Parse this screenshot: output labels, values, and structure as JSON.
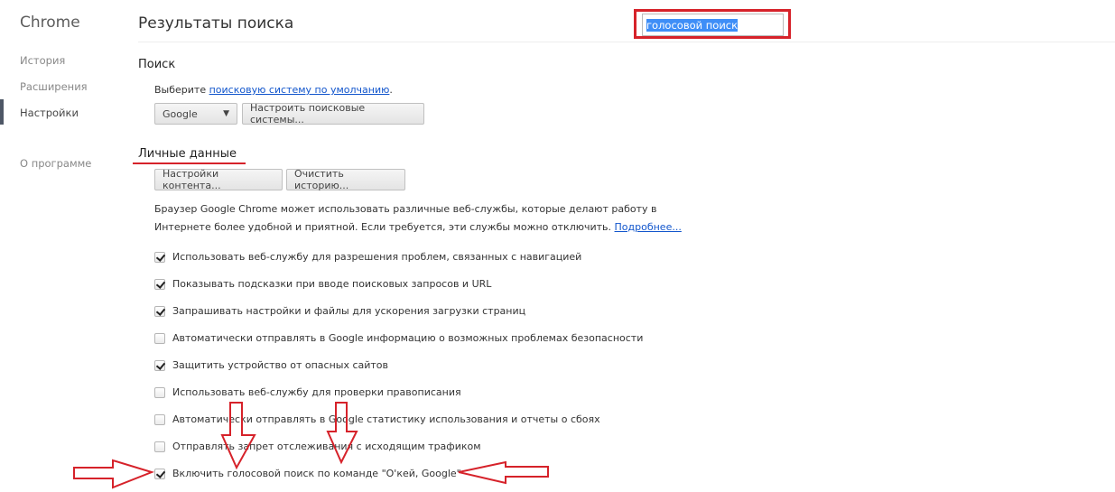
{
  "sidebar": {
    "brand": "Chrome",
    "items": [
      {
        "label": "История"
      },
      {
        "label": "Расширения"
      },
      {
        "label": "Настройки",
        "active": true
      },
      {
        "label": "О программе"
      }
    ]
  },
  "header": {
    "title": "Результаты поиска",
    "search_value": "голосовой поиск"
  },
  "search_section": {
    "heading": "Поиск",
    "prefix": "Выберите ",
    "link": "поисковую систему по умолчанию",
    "suffix": ".",
    "engine": "Google",
    "manage_button": "Настроить поисковые системы..."
  },
  "privacy": {
    "heading": "Личные данные",
    "content_settings": "Настройки контента...",
    "clear_history": "Очистить историю...",
    "description": "Браузер Google Chrome может использовать различные веб-службы, которые делают работу в Интернете более удобной и приятной. Если требуется, эти службы можно отключить. ",
    "more_link": "Подробнее...",
    "options": [
      {
        "label": "Использовать веб-службу для разрешения проблем, связанных с навигацией",
        "checked": true
      },
      {
        "label": "Показывать подсказки при вводе поисковых запросов и URL",
        "checked": true
      },
      {
        "label": "Запрашивать настройки и файлы для ускорения загрузки страниц",
        "checked": true
      },
      {
        "label": "Автоматически отправлять в Google информацию о возможных проблемах безопасности",
        "checked": false
      },
      {
        "label": "Защитить устройство от опасных сайтов",
        "checked": true
      },
      {
        "label": "Использовать веб-службу для проверки правописания",
        "checked": false
      },
      {
        "label": "Автоматически отправлять в Google статистику использования и отчеты о сбоях",
        "checked": false
      },
      {
        "label": "Отправлять запрет отслеживания с исходящим трафиком",
        "checked": false
      },
      {
        "label": "Включить голосовой поиск по команде \"О'кей, Google\"",
        "checked": true
      }
    ]
  },
  "colors": {
    "annotation": "#d6222a",
    "link": "#1155cc",
    "selection": "#3e8ef7"
  }
}
